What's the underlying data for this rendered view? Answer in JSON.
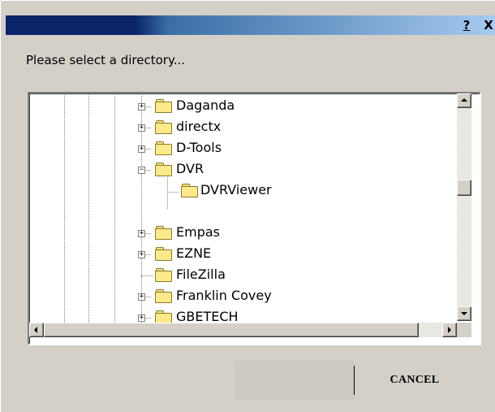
{
  "window": {
    "help_glyph": "?",
    "close_glyph": "X"
  },
  "prompt": "Please select a directory...",
  "tree": {
    "items": [
      {
        "label": "Daganda",
        "expander": "+"
      },
      {
        "label": "directx",
        "expander": "+"
      },
      {
        "label": "D-Tools",
        "expander": "+"
      },
      {
        "label": "DVR",
        "expander": "−"
      },
      {
        "label": "DVRViewer",
        "expander": ""
      },
      {
        "label": "Empas",
        "expander": "+"
      },
      {
        "label": "EZNE",
        "expander": "+"
      },
      {
        "label": "FileZilla",
        "expander": ""
      },
      {
        "label": "Franklin Covey",
        "expander": "+"
      },
      {
        "label": "GBETECH",
        "expander": "+"
      }
    ]
  },
  "buttons": {
    "ok_label": "",
    "cancel_label": "CANCEL"
  }
}
